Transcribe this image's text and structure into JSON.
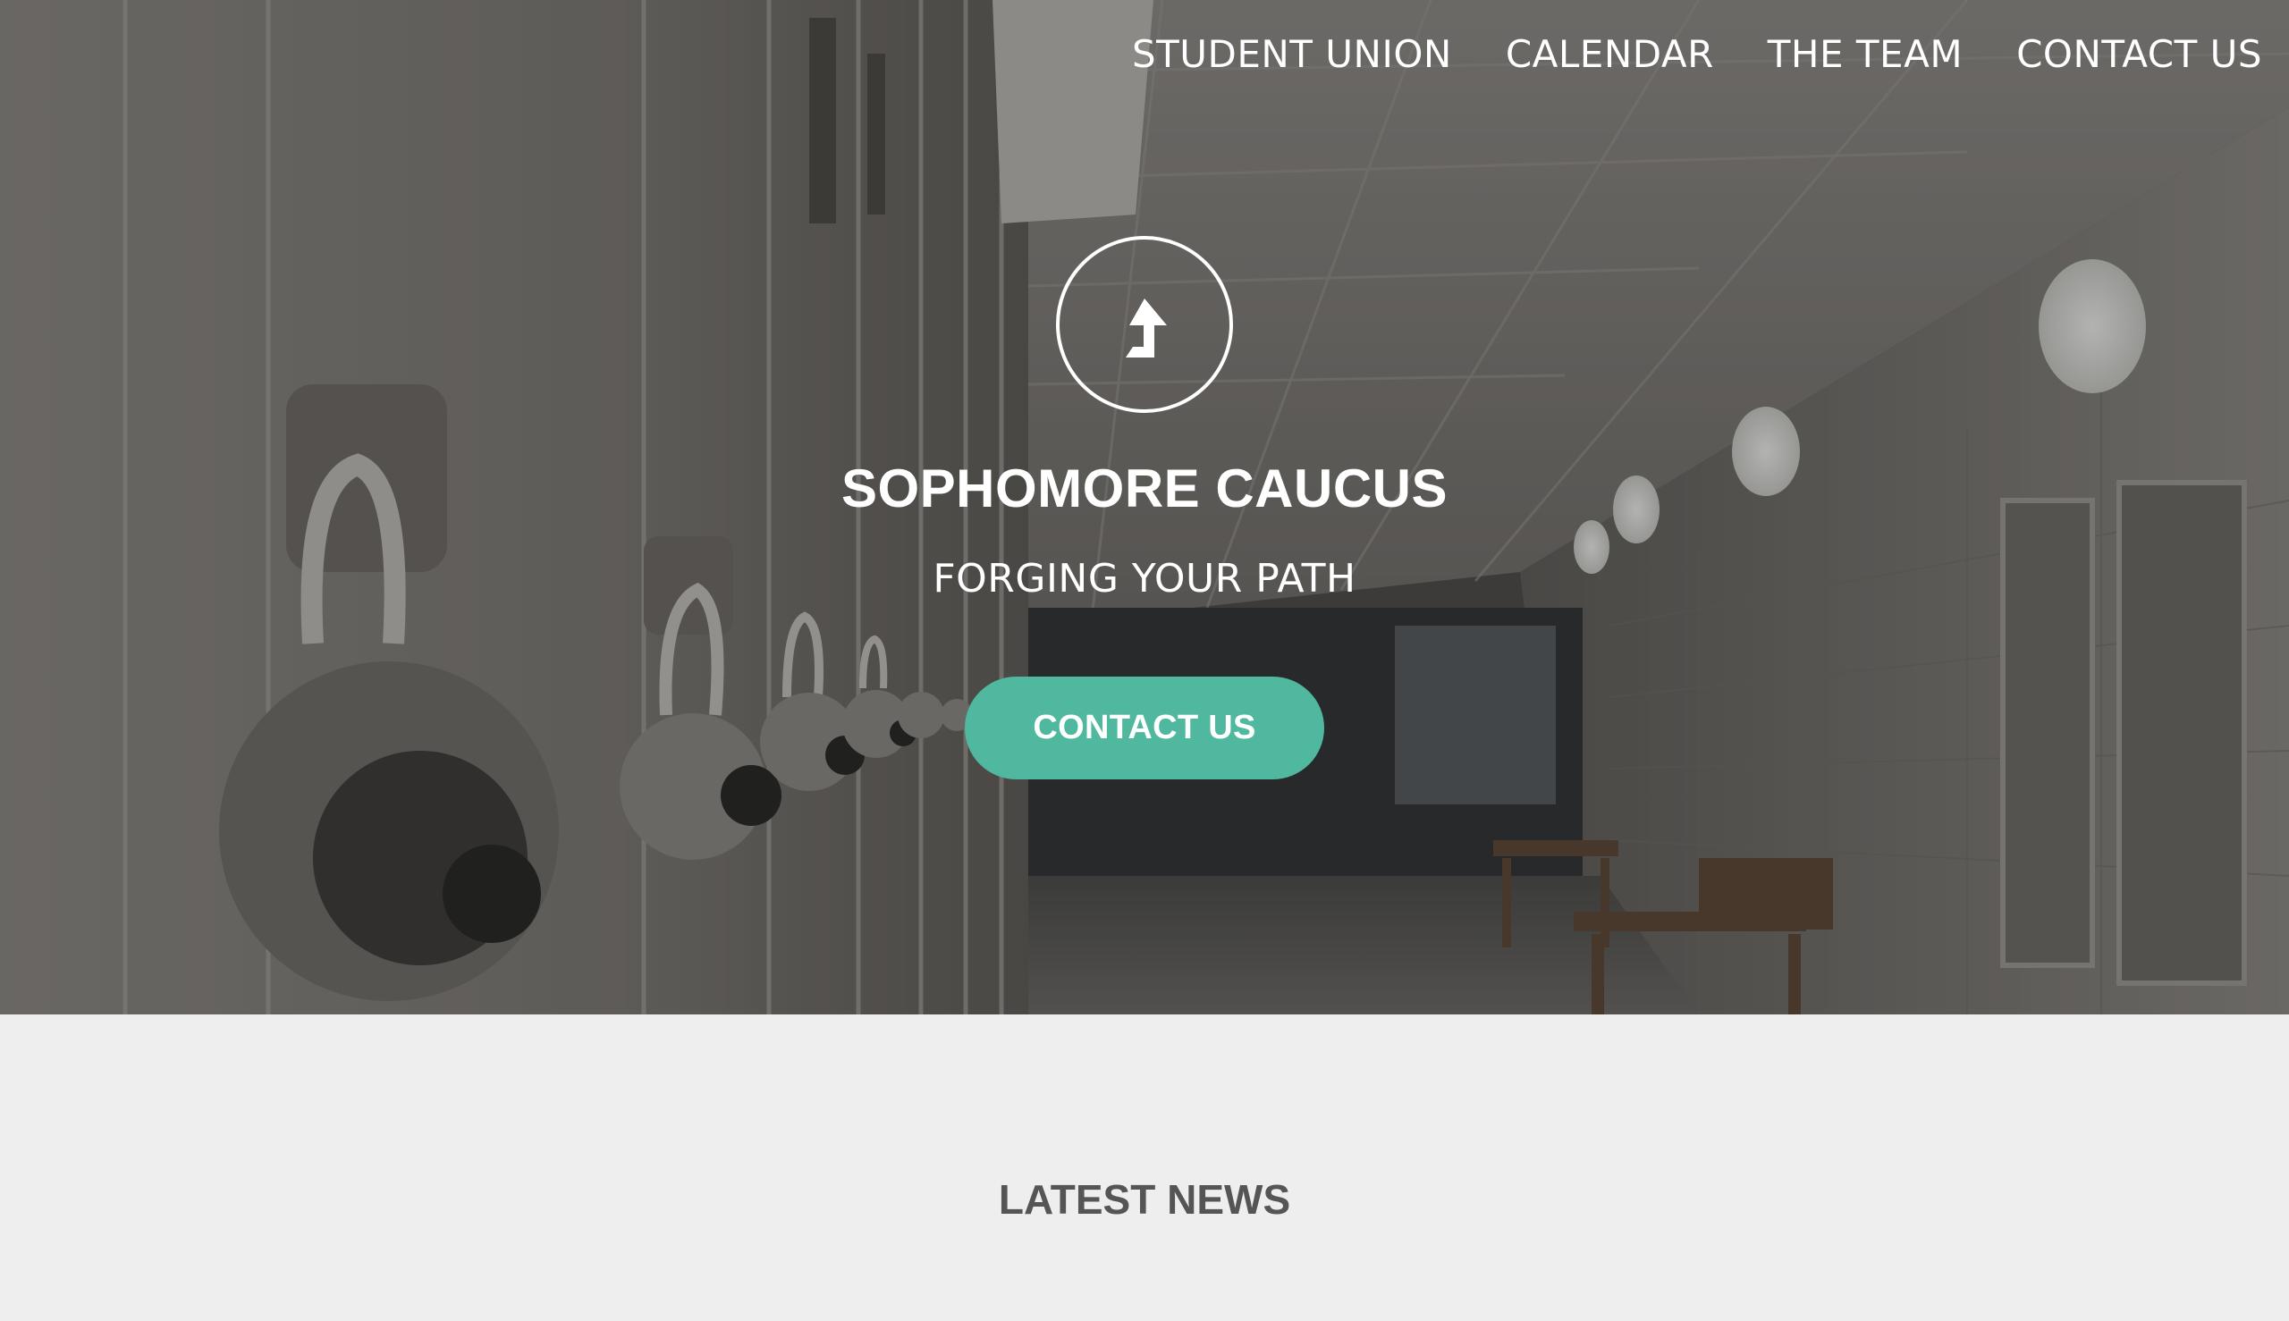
{
  "nav": {
    "items": [
      {
        "label": "STUDENT UNION"
      },
      {
        "label": "CALENDAR"
      },
      {
        "label": "THE TEAM"
      },
      {
        "label": "CONTACT US"
      }
    ]
  },
  "hero": {
    "logo_icon": "turn-up-arrow-icon",
    "title": "SOPHOMORE CAUCUS",
    "subtitle": "FORGING YOUR PATH",
    "cta_label": "CONTACT US",
    "background_image": "school-hallway-lockers-photo"
  },
  "news": {
    "heading": "LATEST NEWS"
  },
  "colors": {
    "accent": "#4fb89f",
    "heading_text": "#555555",
    "section_bg": "#eeeeee"
  }
}
